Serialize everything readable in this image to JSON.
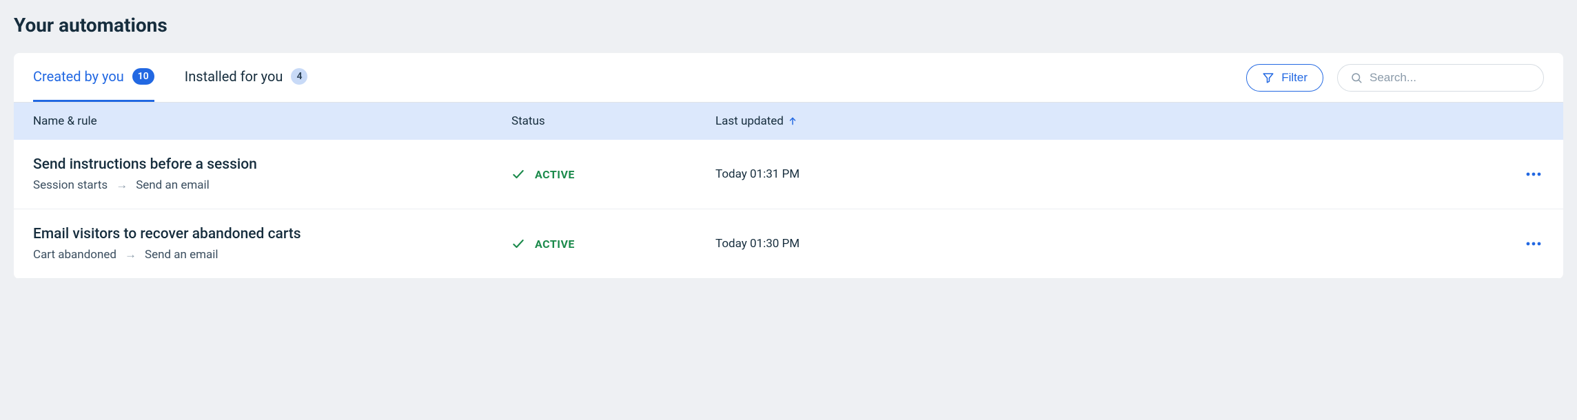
{
  "page": {
    "title": "Your automations"
  },
  "tabs": {
    "created": {
      "label": "Created by you",
      "count": "10"
    },
    "installed": {
      "label": "Installed for you",
      "count": "4"
    }
  },
  "actions": {
    "filter_label": "Filter",
    "search_placeholder": "Search..."
  },
  "columns": {
    "name": "Name & rule",
    "status": "Status",
    "updated": "Last updated"
  },
  "rows": [
    {
      "title": "Send instructions before a session",
      "trigger": "Session starts",
      "action": "Send an email",
      "status": "ACTIVE",
      "updated": "Today 01:31 PM"
    },
    {
      "title": "Email visitors to recover abandoned carts",
      "trigger": "Cart abandoned",
      "action": "Send an email",
      "status": "ACTIVE",
      "updated": "Today 01:30 PM"
    }
  ]
}
